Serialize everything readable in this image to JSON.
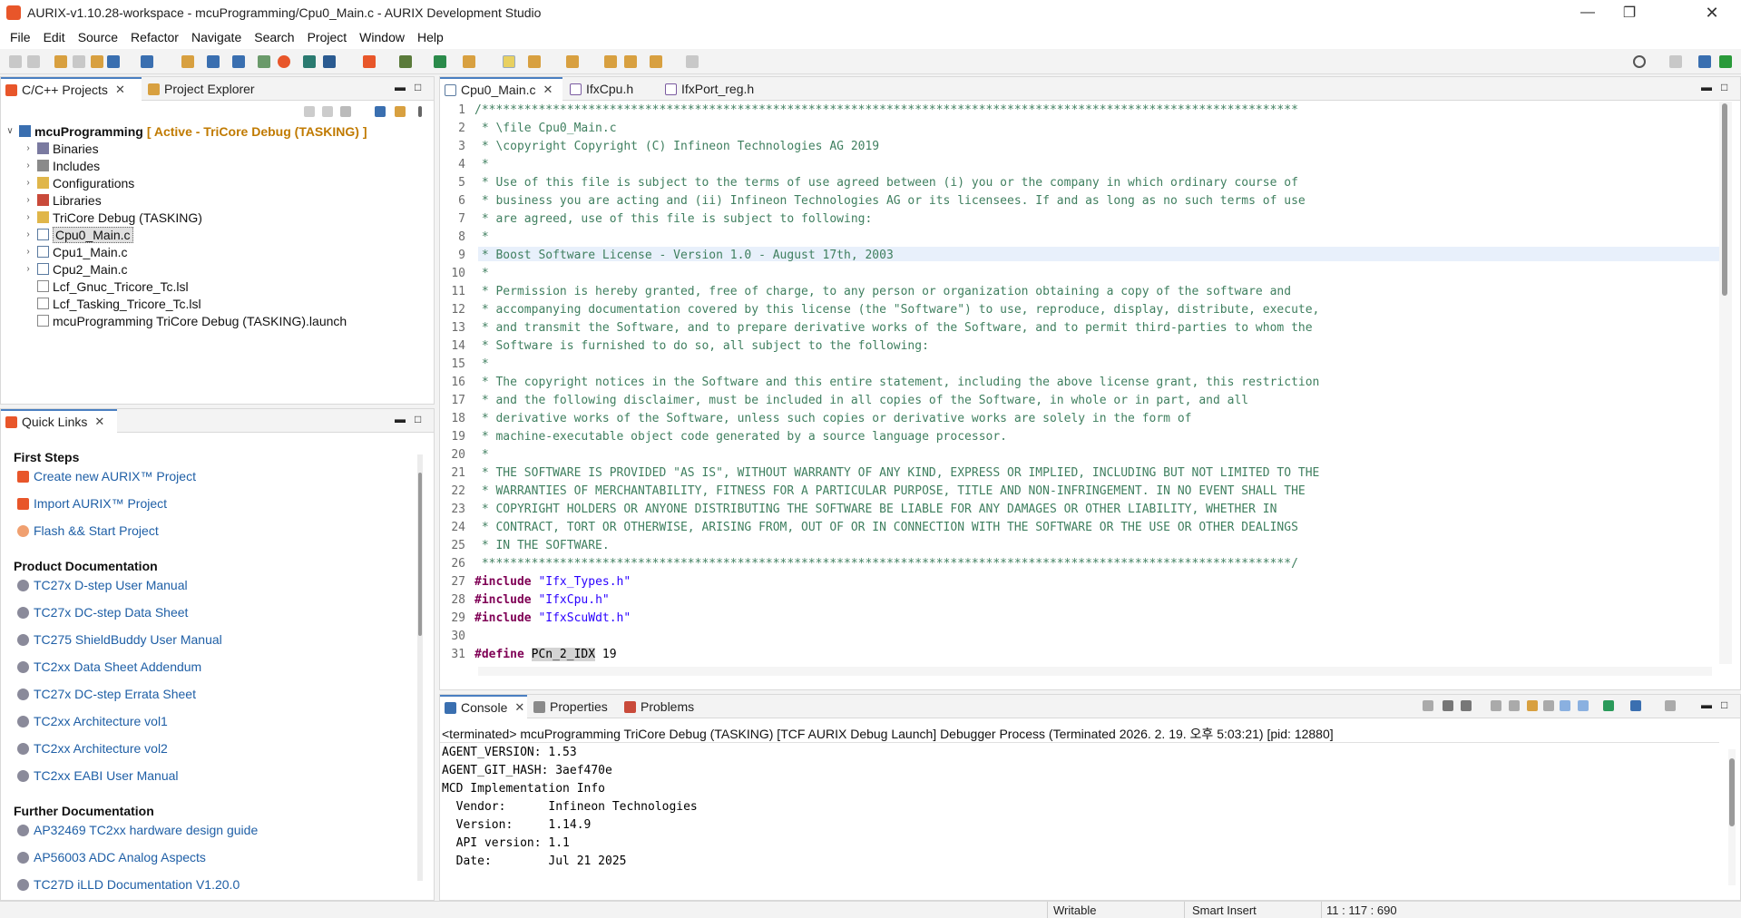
{
  "window": {
    "title": "AURIX-v1.10.28-workspace - mcuProgramming/Cpu0_Main.c - AURIX Development Studio"
  },
  "menu": [
    "File",
    "Edit",
    "Source",
    "Refactor",
    "Navigate",
    "Search",
    "Project",
    "Window",
    "Help"
  ],
  "project_panel": {
    "tabs": [
      "C/C++ Projects",
      "Project Explorer"
    ],
    "root": {
      "name": "mcuProgramming",
      "status": "[ Active - TriCore Debug (TASKING) ]"
    },
    "items": [
      {
        "label": "Binaries",
        "expandable": true
      },
      {
        "label": "Includes",
        "expandable": true
      },
      {
        "label": "Configurations",
        "expandable": true
      },
      {
        "label": "Libraries",
        "expandable": true
      },
      {
        "label": "TriCore Debug (TASKING)",
        "expandable": true
      },
      {
        "label": "Cpu0_Main.c",
        "expandable": true,
        "selected": true
      },
      {
        "label": "Cpu1_Main.c",
        "expandable": true
      },
      {
        "label": "Cpu2_Main.c",
        "expandable": true
      },
      {
        "label": "Lcf_Gnuc_Tricore_Tc.lsl",
        "expandable": false
      },
      {
        "label": "Lcf_Tasking_Tricore_Tc.lsl",
        "expandable": false
      },
      {
        "label": "mcuProgramming TriCore Debug (TASKING).launch",
        "expandable": false
      }
    ]
  },
  "quick_links": {
    "tab": "Quick Links",
    "sections": [
      {
        "heading": "First Steps",
        "items": [
          "Create new AURIX™ Project",
          "Import AURIX™ Project",
          "Flash && Start Project"
        ]
      },
      {
        "heading": "Product Documentation",
        "items": [
          "TC27x D-step User Manual",
          "TC27x DC-step Data Sheet",
          "TC275 ShieldBuddy User Manual",
          "TC2xx Data Sheet Addendum",
          "TC27x DC-step Errata Sheet",
          "TC2xx Architecture vol1",
          "TC2xx Architecture vol2",
          "TC2xx EABI User Manual"
        ]
      },
      {
        "heading": "Further Documentation",
        "items": [
          "AP32469 TC2xx hardware design guide",
          "AP56003 ADC Analog Aspects",
          "TC27D iLLD Documentation V1.20.0"
        ]
      }
    ]
  },
  "editor": {
    "tabs": [
      "Cpu0_Main.c",
      "IfxCpu.h",
      "IfxPort_reg.h"
    ],
    "lines": [
      {
        "n": "1",
        "t": "/*******************************************************************************************************************"
      },
      {
        "n": "2",
        "t": " * \\file Cpu0_Main.c"
      },
      {
        "n": "3",
        "t": " * \\copyright Copyright (C) Infineon Technologies AG 2019"
      },
      {
        "n": "4",
        "t": " *"
      },
      {
        "n": "5",
        "t": " * Use of this file is subject to the terms of use agreed between (i) you or the company in which ordinary course of"
      },
      {
        "n": "6",
        "t": " * business you are acting and (ii) Infineon Technologies AG or its licensees. If and as long as no such terms of use"
      },
      {
        "n": "7",
        "t": " * are agreed, use of this file is subject to following:"
      },
      {
        "n": "8",
        "t": " *"
      },
      {
        "n": "9",
        "t": " * Boost Software License - Version 1.0 - August 17th, 2003"
      },
      {
        "n": "10",
        "t": " *"
      },
      {
        "n": "11",
        "t": " * Permission is hereby granted, free of charge, to any person or organization obtaining a copy of the software and "
      },
      {
        "n": "12",
        "t": " * accompanying documentation covered by this license (the \"Software\") to use, reproduce, display, distribute, execute,"
      },
      {
        "n": "13",
        "t": " * and transmit the Software, and to prepare derivative works of the Software, and to permit third-parties to whom the"
      },
      {
        "n": "14",
        "t": " * Software is furnished to do so, all subject to the following:"
      },
      {
        "n": "15",
        "t": " *"
      },
      {
        "n": "16",
        "t": " * The copyright notices in the Software and this entire statement, including the above license grant, this restriction"
      },
      {
        "n": "17",
        "t": " * and the following disclaimer, must be included in all copies of the Software, in whole or in part, and all"
      },
      {
        "n": "18",
        "t": " * derivative works of the Software, unless such copies or derivative works are solely in the form of"
      },
      {
        "n": "19",
        "t": " * machine-executable object code generated by a source language processor."
      },
      {
        "n": "20",
        "t": " *"
      },
      {
        "n": "21",
        "t": " * THE SOFTWARE IS PROVIDED \"AS IS\", WITHOUT WARRANTY OF ANY KIND, EXPRESS OR IMPLIED, INCLUDING BUT NOT LIMITED TO THE"
      },
      {
        "n": "22",
        "t": " * WARRANTIES OF MERCHANTABILITY, FITNESS FOR A PARTICULAR PURPOSE, TITLE AND NON-INFRINGEMENT. IN NO EVENT SHALL THE"
      },
      {
        "n": "23",
        "t": " * COPYRIGHT HOLDERS OR ANYONE DISTRIBUTING THE SOFTWARE BE LIABLE FOR ANY DAMAGES OR OTHER LIABILITY, WHETHER IN"
      },
      {
        "n": "24",
        "t": " * CONTRACT, TORT OR OTHERWISE, ARISING FROM, OUT OF OR IN CONNECTION WITH THE SOFTWARE OR THE USE OR OTHER DEALINGS"
      },
      {
        "n": "25",
        "t": " * IN THE SOFTWARE."
      },
      {
        "n": "26",
        "t": " ******************************************************************************************************************/"
      }
    ],
    "includes": [
      {
        "n": "27",
        "kw": "#include",
        "s": "\"Ifx_Types.h\""
      },
      {
        "n": "28",
        "kw": "#include",
        "s": "\"IfxCpu.h\""
      },
      {
        "n": "29",
        "kw": "#include",
        "s": "\"IfxScuWdt.h\""
      }
    ],
    "line30": "30",
    "define": {
      "n": "31",
      "kw": "#define",
      "name": "PCn_2_IDX",
      "value": " 19"
    }
  },
  "console": {
    "tabs": [
      "Console",
      "Properties",
      "Problems"
    ],
    "header": "<terminated> mcuProgramming TriCore Debug (TASKING) [TCF AURIX Debug Launch] Debugger Process (Terminated 2026. 2. 19. 오후 5:03:21) [pid: 12880]",
    "lines": [
      "AGENT_VERSION: 1.53",
      "AGENT_GIT_HASH: 3aef470e",
      "MCD Implementation Info",
      "  Vendor:      Infineon Technologies",
      "  Version:     1.14.9",
      "  API version: 1.1",
      "  Date:        Jul 21 2025"
    ]
  },
  "status": {
    "writable": "Writable",
    "insert_mode": "Smart Insert",
    "position": "11 : 117 : 690"
  },
  "colors": {
    "accent": "#e8562a",
    "link": "#1f5fa6",
    "comment": "#3f7f5f",
    "keyword": "#7f0055",
    "string": "#2a00ff"
  }
}
